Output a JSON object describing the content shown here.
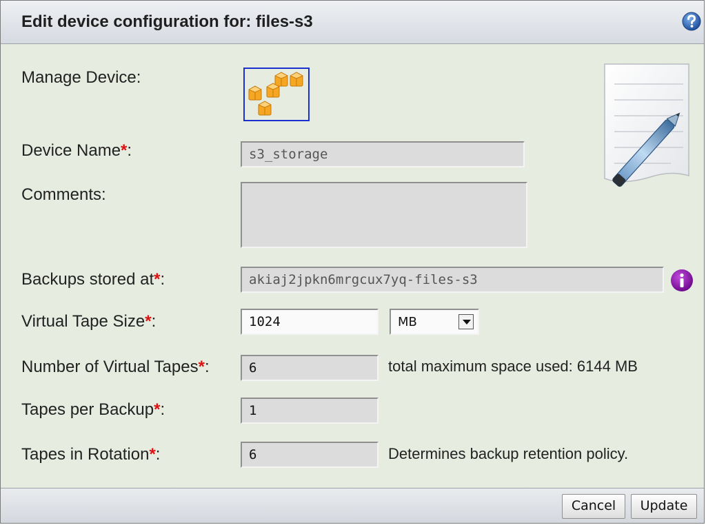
{
  "dialog": {
    "title": "Edit device configuration for: files-s3"
  },
  "icons": {
    "help": "help-icon",
    "device": "aws-cubes-icon",
    "document": "document-pencil-icon",
    "info": "info-icon"
  },
  "form": {
    "manage_device_label": "Manage Device:",
    "device_name_label": "Device Name",
    "device_name_value": "s3_storage",
    "comments_label": "Comments:",
    "comments_value": "",
    "backups_label": "Backups stored at",
    "backups_value": "akiaj2jpkn6mrgcux7yq-files-s3",
    "tape_size_label": "Virtual Tape Size",
    "tape_size_value": "1024",
    "tape_size_unit": "MB",
    "num_tapes_label": "Number of Virtual Tapes",
    "num_tapes_value": "6",
    "num_tapes_note": "total maximum space used: 6144 MB",
    "tapes_per_backup_label": "Tapes per Backup",
    "tapes_per_backup_value": "1",
    "tapes_rotation_label": "Tapes in Rotation",
    "tapes_rotation_value": "6",
    "tapes_rotation_note": "Determines backup retention policy.",
    "required_mark": "*",
    "colon": ":"
  },
  "footer": {
    "cancel_label": "Cancel",
    "update_label": "Update"
  },
  "colors": {
    "panel_bg": "#e6ecdf",
    "required": "#dd1111",
    "info_purple": "#8a1aa6",
    "help_blue": "#2a63b8"
  }
}
